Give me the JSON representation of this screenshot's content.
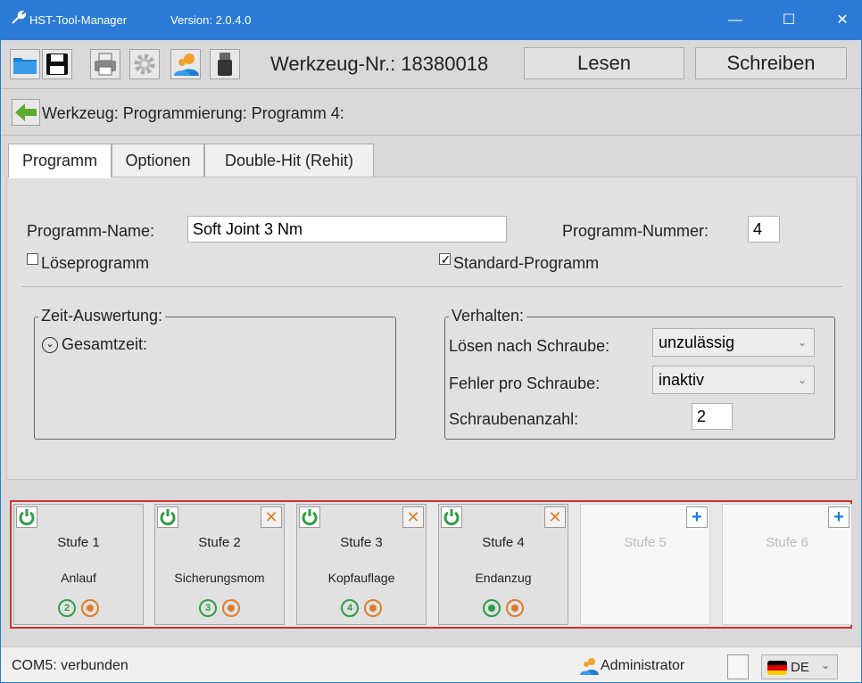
{
  "window": {
    "title": "HST-Tool-Manager",
    "version": "Version: 2.0.4.0",
    "controls": {
      "minimize": "—",
      "maximize": "☐",
      "close": "✕"
    }
  },
  "toolbar": {
    "tool_number": "Werkzeug-Nr.: 18380018",
    "read_label": "Lesen",
    "write_label": "Schreiben",
    "icons": [
      "folder-icon",
      "save-icon",
      "print-icon",
      "settings-icon",
      "user-icon",
      "usb-icon"
    ]
  },
  "breadcrumb": "Werkzeug: Programmierung: Programm 4:",
  "tabs": [
    "Programm",
    "Optionen",
    "Double-Hit (Rehit)"
  ],
  "program": {
    "name_label": "Programm-Name:",
    "name_value": "Soft Joint 3 Nm",
    "number_label": "Programm-Nummer:",
    "number_value": "4",
    "loosen_label": "Löseprogramm",
    "loosen_checked": false,
    "standard_label": "Standard-Programm",
    "standard_checked": true
  },
  "time_group": {
    "title": "Zeit-Auswertung:",
    "total_label": "Gesamtzeit:"
  },
  "behavior_group": {
    "title": "Verhalten:",
    "loosen_after_label": "Lösen nach Schraube:",
    "loosen_after_value": "unzulässig",
    "error_label": "Fehler pro Schraube:",
    "error_value": "inaktiv",
    "count_label": "Schraubenanzahl:",
    "count_value": "2"
  },
  "stages": [
    {
      "name": "Stufe 1",
      "desc": "Anlauf",
      "num": "2"
    },
    {
      "name": "Stufe 2",
      "desc": "Sicherungsmom",
      "num": "3"
    },
    {
      "name": "Stufe 3",
      "desc": "Kopfauflage",
      "num": "4"
    },
    {
      "name": "Stufe 4",
      "desc": "Endanzug",
      "num": ""
    },
    {
      "name": "Stufe 5"
    },
    {
      "name": "Stufe 6"
    }
  ],
  "status": {
    "connection": "COM5: verbunden",
    "user": "Administrator",
    "language": "DE"
  },
  "colors": {
    "titlebar": "#2b7bd6",
    "stage_border": "#d32f2f",
    "green": "#2e9e44",
    "orange": "#e07b2a",
    "blue": "#1a7fd6"
  }
}
